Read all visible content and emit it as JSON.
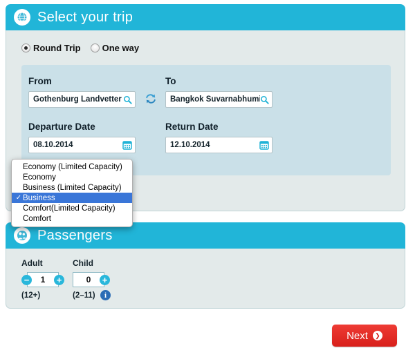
{
  "trip": {
    "header": {
      "title": "Select your trip",
      "icon": "globe-icon"
    },
    "trip_type": {
      "options": [
        {
          "label": "Round Trip",
          "selected": true
        },
        {
          "label": "One way",
          "selected": false
        }
      ]
    },
    "from": {
      "label": "From",
      "value": "Gothenburg Landvetter A",
      "icon": "search-icon"
    },
    "to": {
      "label": "To",
      "value": "Bangkok Suvarnabhumi A",
      "icon": "search-icon"
    },
    "swap": {
      "icon": "swap-arrows-icon"
    },
    "departure": {
      "label": "Departure Date",
      "value": "08.10.2014",
      "icon": "calendar-icon"
    },
    "return": {
      "label": "Return Date",
      "value": "12.10.2014",
      "icon": "calendar-icon"
    }
  },
  "cabin_dropdown": {
    "open": true,
    "selected": "Business",
    "check_glyph": "✓",
    "options": [
      {
        "label": "Economy (Limited Capacity)",
        "selected": false
      },
      {
        "label": "Economy",
        "selected": false
      },
      {
        "label": "Business (Limited Capacity)",
        "selected": false
      },
      {
        "label": "Business",
        "selected": true
      },
      {
        "label": "Comfort(Limited Capacity)",
        "selected": false
      },
      {
        "label": "Comfort",
        "selected": false
      }
    ]
  },
  "passengers": {
    "header": {
      "title": "Passengers",
      "icon": "passengers-icon"
    },
    "adult": {
      "label": "Adult",
      "value": "1",
      "age_note": "(12+)",
      "minus_label": "−",
      "plus_label": "+",
      "has_minus": true
    },
    "child": {
      "label": "Child",
      "value": "0",
      "age_note": "(2–11)",
      "plus_label": "+",
      "has_minus": false,
      "info_glyph": "i"
    }
  },
  "footer": {
    "next_label": "Next",
    "next_arrow_glyph": "❯"
  },
  "colors": {
    "header_cyan": "#21b5d8",
    "card_body": "#e3eaea",
    "form_panel": "#cae0e8",
    "accent_cyan": "#29b7db",
    "dropdown_highlight": "#3a76d8",
    "next_red": "#d8201b",
    "info_blue": "#2b6cb5"
  }
}
